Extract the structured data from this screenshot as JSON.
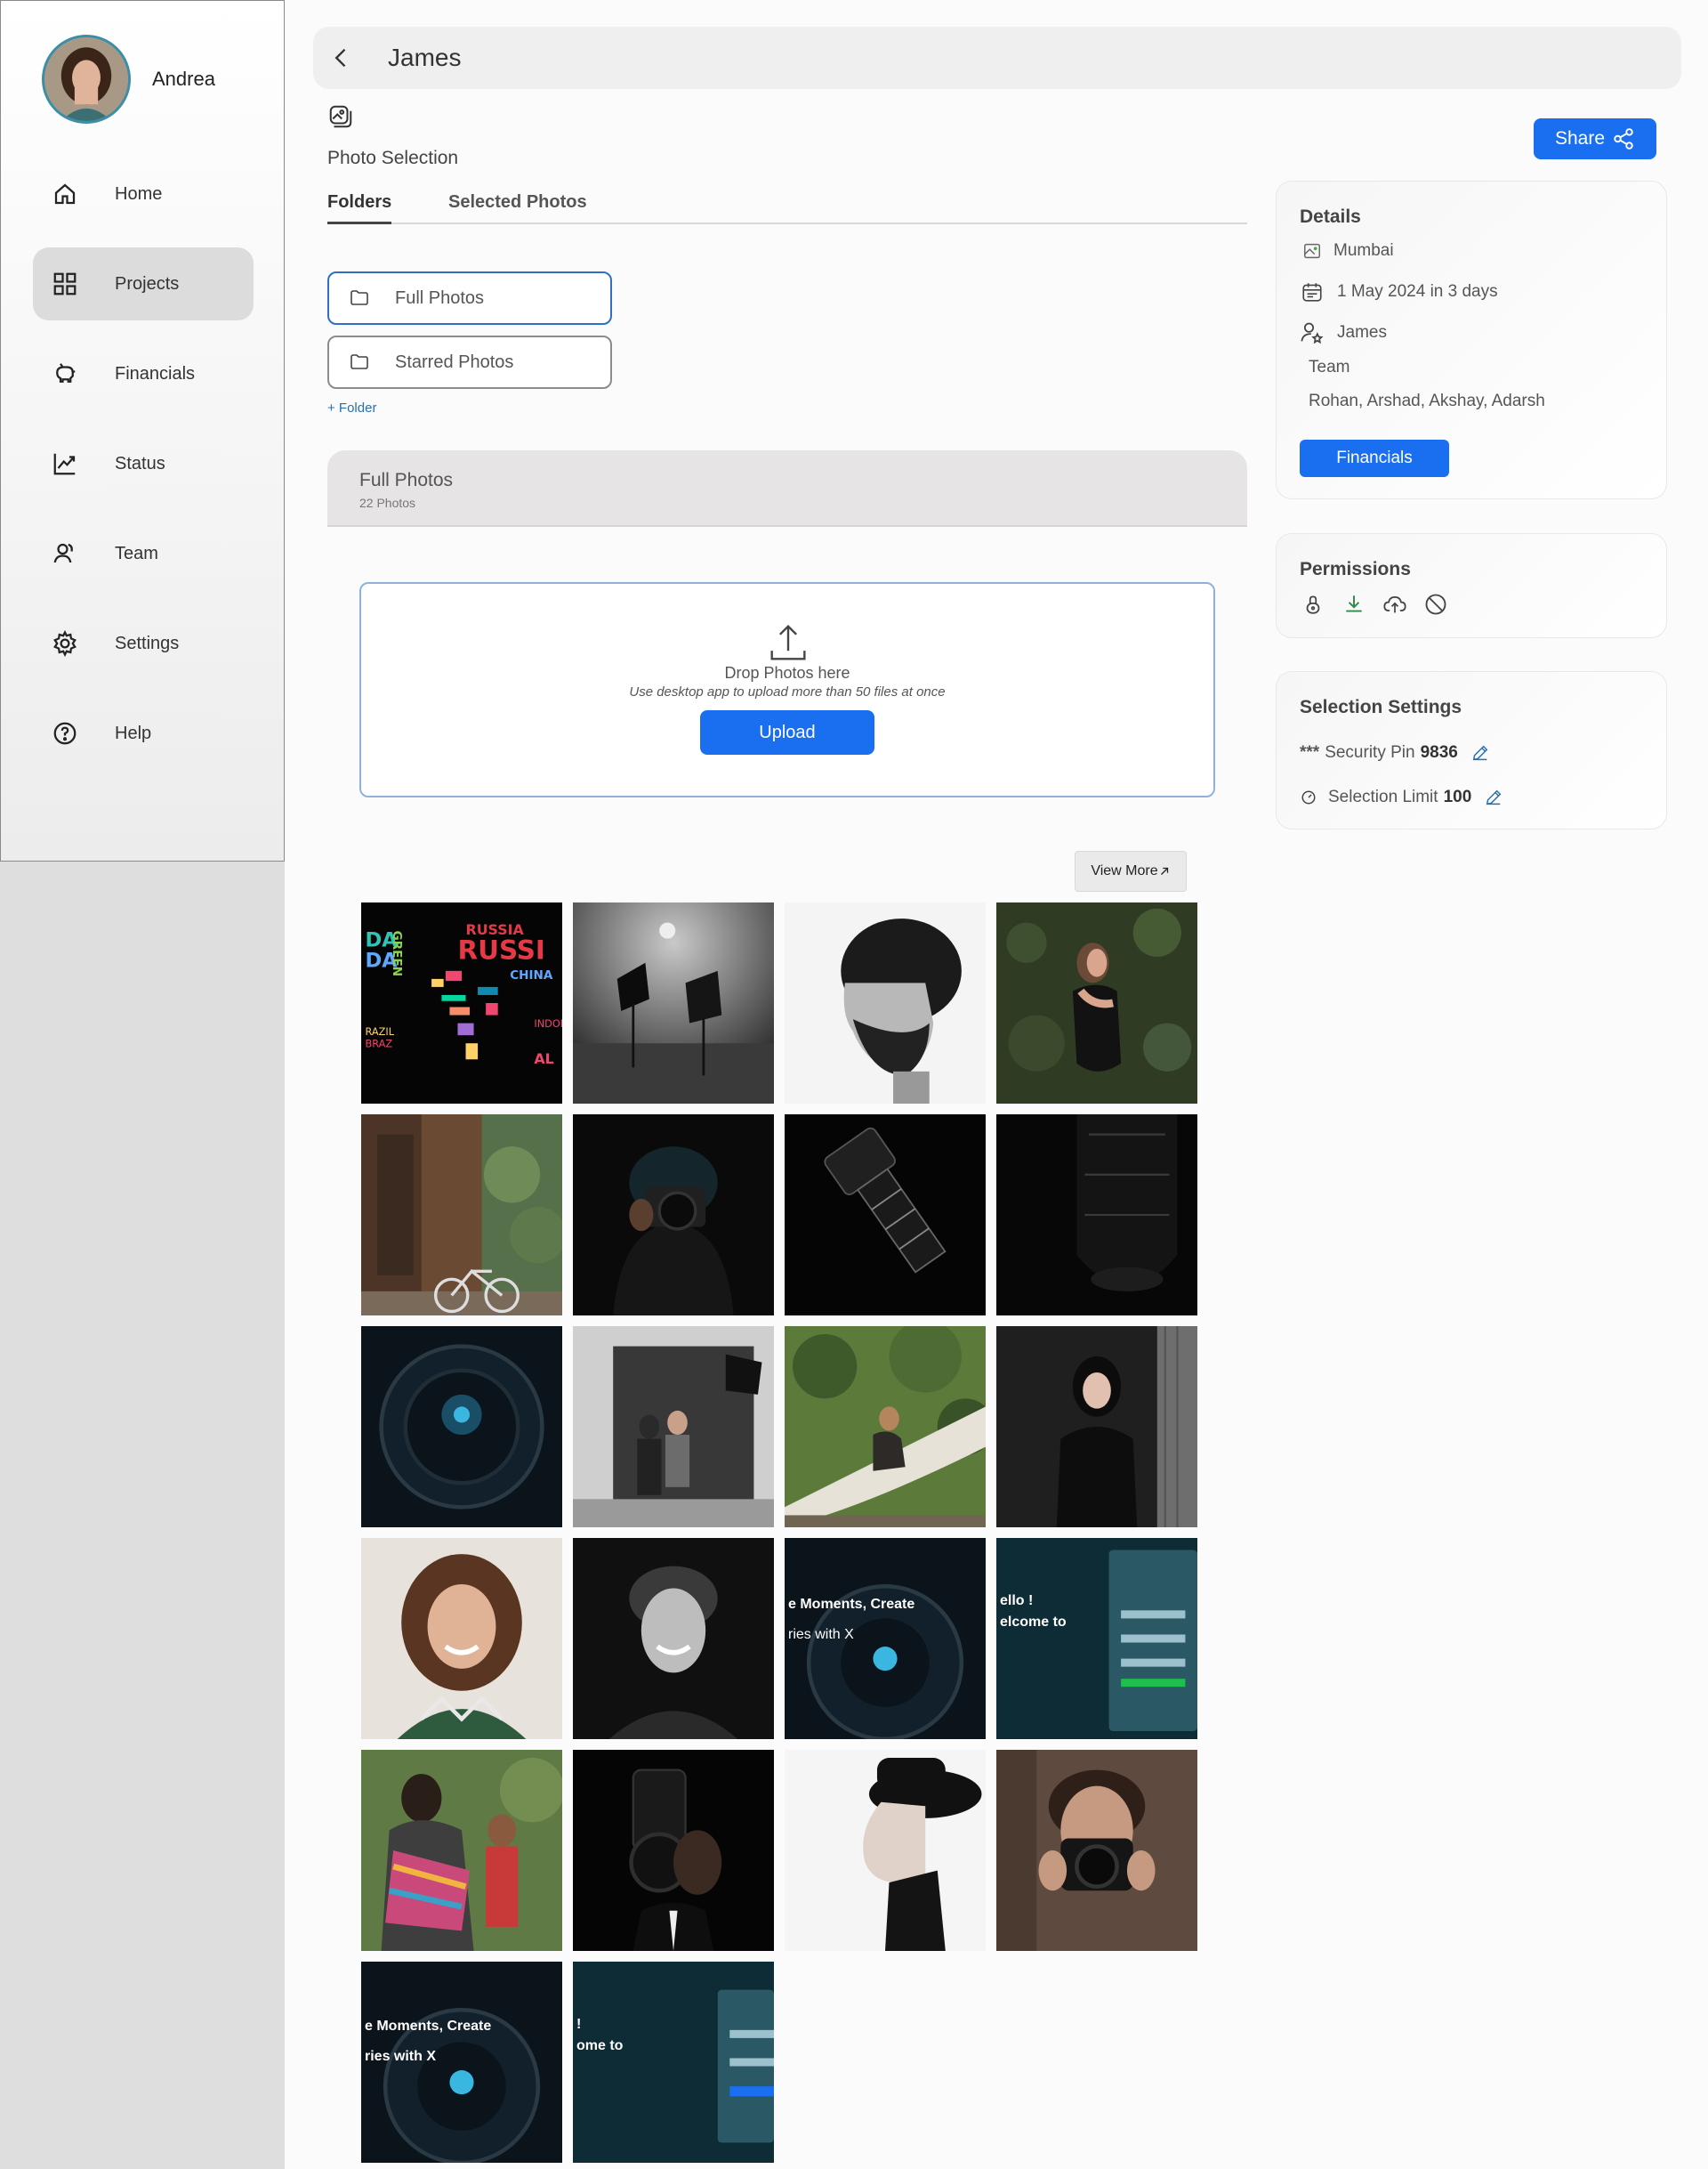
{
  "user": {
    "name": "Andrea"
  },
  "sidebar": {
    "items": [
      {
        "label": "Home",
        "icon": "home-icon"
      },
      {
        "label": "Projects",
        "icon": "grid-icon"
      },
      {
        "label": "Financials",
        "icon": "piggy-bank-icon"
      },
      {
        "label": "Status",
        "icon": "chart-line-icon"
      },
      {
        "label": "Team",
        "icon": "team-icon"
      },
      {
        "label": "Settings",
        "icon": "gear-icon"
      },
      {
        "label": "Help",
        "icon": "help-icon"
      }
    ],
    "active": "Projects"
  },
  "header": {
    "title": "James"
  },
  "page": {
    "section_title": "Photo Selection"
  },
  "tabs": [
    {
      "label": "Folders"
    },
    {
      "label": "Selected Photos"
    }
  ],
  "folders": [
    {
      "label": "Full Photos"
    },
    {
      "label": "Starred Photos"
    }
  ],
  "add_folder_label": "+ Folder",
  "folder_header": {
    "title": "Full Photos",
    "count": "22 Photos"
  },
  "dropzone": {
    "title": "Drop Photos here",
    "subtitle": "Use desktop app to upload more than 50 files at once",
    "button": "Upload"
  },
  "view_more_label": "View More",
  "gallery": {
    "photos": [
      {
        "subject": "world-map-words"
      },
      {
        "subject": "photo-studio"
      },
      {
        "subject": "bearded-man-profile"
      },
      {
        "subject": "woman-ivy"
      },
      {
        "subject": "bicycle-doorway"
      },
      {
        "subject": "photographer-dark"
      },
      {
        "subject": "camera-lens-dark"
      },
      {
        "subject": "lens-closeup"
      },
      {
        "subject": "lens-blue"
      },
      {
        "subject": "studio-shoot"
      },
      {
        "subject": "woman-on-log"
      },
      {
        "subject": "woman-black-coat"
      },
      {
        "subject": "smiling-woman"
      },
      {
        "subject": "smiling-man-bw"
      },
      {
        "subject": "lens-text-banner",
        "text": [
          "e Moments, Create",
          "ries with X"
        ]
      },
      {
        "subject": "signup-screen",
        "text": [
          "ello !",
          "elcome to"
        ]
      },
      {
        "subject": "woman-carrying-baby"
      },
      {
        "subject": "man-with-camera-dark"
      },
      {
        "subject": "man-in-hat"
      },
      {
        "subject": "photographer-camera"
      },
      {
        "subject": "lens-text-banner-2",
        "text": [
          "e Moments, Create",
          "ries with X"
        ]
      },
      {
        "subject": "signup-screen-2",
        "text": [
          "! ",
          "ome to"
        ]
      }
    ]
  },
  "share": {
    "label": "Share"
  },
  "details": {
    "title": "Details",
    "location": "Mumbai",
    "date": "1 May 2024 in 3 days",
    "client": "James",
    "team_label": "Team",
    "team_members": "Rohan, Arshad, Akshay, Adarsh",
    "financials_button": "Financials"
  },
  "permissions": {
    "title": "Permissions",
    "icons": [
      "lock-icon",
      "download-icon",
      "cloud-upload-icon",
      "ban-icon"
    ]
  },
  "selection_settings": {
    "title": "Selection Settings",
    "pin_prefix": "***",
    "pin_label": "Security Pin",
    "pin_value": "9836",
    "limit_label": "Selection Limit",
    "limit_value": "100"
  },
  "colors": {
    "accent": "#1a6ff0",
    "sidebar_active": "#dcdcdc"
  }
}
